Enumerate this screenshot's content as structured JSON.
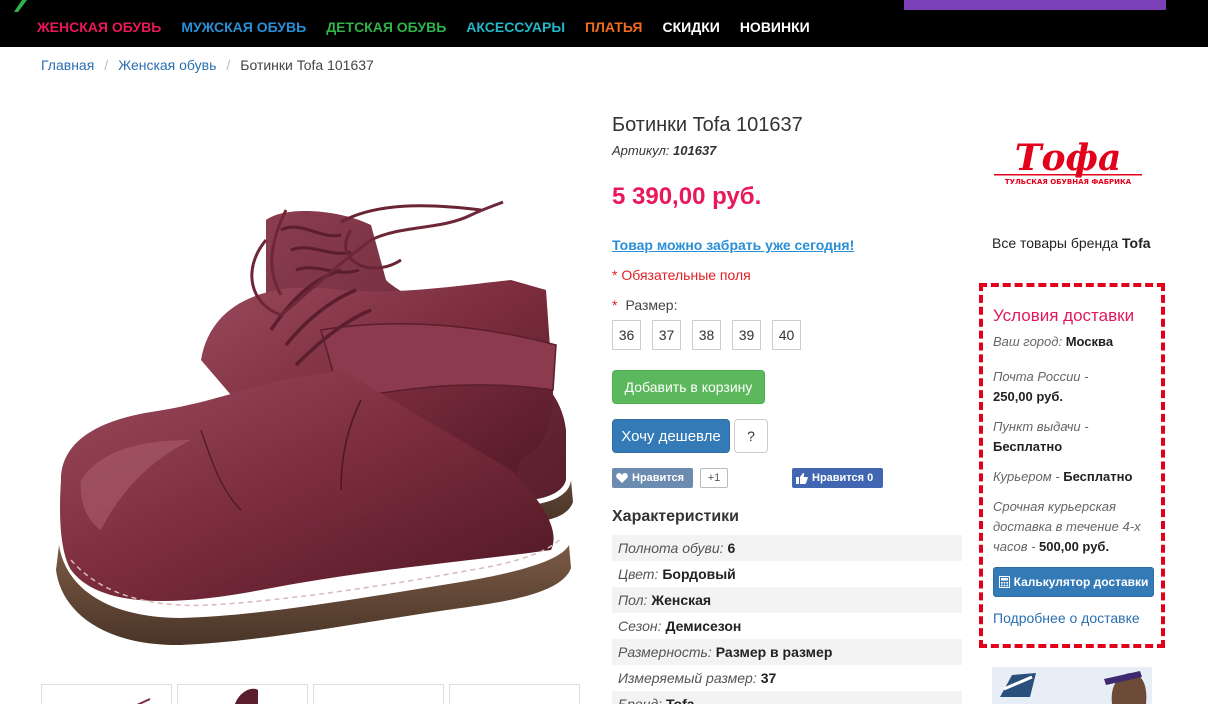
{
  "nav": {
    "items": [
      {
        "label": "ЖЕНСКАЯ ОБУВЬ",
        "color": "#e8185a"
      },
      {
        "label": "МУЖСКАЯ ОБУВЬ",
        "color": "#2a8fd6"
      },
      {
        "label": "ДЕТСКАЯ ОБУВЬ",
        "color": "#2fb34a"
      },
      {
        "label": "АКСЕССУАРЫ",
        "color": "#23b5c8"
      },
      {
        "label": "ПЛАТЬЯ",
        "color": "#f06a1f"
      },
      {
        "label": "СКИДКИ",
        "color": "#ffffff"
      },
      {
        "label": "НОВИНКИ",
        "color": "#ffffff"
      }
    ]
  },
  "breadcrumb": {
    "home": "Главная",
    "section": "Женская обувь",
    "current": "Ботинки Tofa 101637",
    "separator": "/"
  },
  "product": {
    "title": "Ботинки Tofa 101637",
    "sku_label": "Артикул:",
    "sku": "101637",
    "price": "5 390,00 руб.",
    "pickup_today": "Товар можно забрать уже сегодня!",
    "required_note": "* Обязательные поля",
    "size_star": "*",
    "size_label": "Размер:",
    "sizes": [
      "36",
      "37",
      "38",
      "39",
      "40"
    ],
    "add_to_cart": "Добавить в корзину",
    "want_cheaper": "Хочу дешевле",
    "question": "?"
  },
  "social": {
    "vk_like": "Нравится",
    "vk_count": "+1",
    "fb_like": "Нравится 0"
  },
  "characteristics": {
    "title": "Характеристики",
    "rows": [
      {
        "key": "Полнота обуви:",
        "value": "6"
      },
      {
        "key": "Цвет:",
        "value": "Бордовый"
      },
      {
        "key": "Пол:",
        "value": "Женская"
      },
      {
        "key": "Сезон:",
        "value": "Демисезон"
      },
      {
        "key": "Размерность:",
        "value": "Размер в размер"
      },
      {
        "key": "Измеряемый размер:",
        "value": "37"
      },
      {
        "key": "Бренд:",
        "value": "Tofa"
      }
    ]
  },
  "brand": {
    "logo_text": "Тофа",
    "logo_subtext": "ТУЛЬСКАЯ ОБУВНАЯ ФАБРИКА",
    "all_goods": "Все товары бренда",
    "name": "Tofa"
  },
  "delivery": {
    "title": "Условия доставки",
    "city_label": "Ваш город:",
    "city": "Москва",
    "post_label": "Почта России -",
    "post_price": "250,00 руб.",
    "pickup_label": "Пункт выдачи -",
    "pickup_price": "Бесплатно",
    "courier_label": "Курьером -",
    "courier_price": "Бесплатно",
    "express_label": "Срочная курьерская доставка в течение 4-х часов -",
    "express_price": "500,00 руб.",
    "calc_button": "Калькулятор доставки",
    "more_link": "Подробнее о доставке"
  },
  "colors": {
    "accent_price": "#e8185a",
    "delivery_border": "#e3001b",
    "primary_button": "#337ab7",
    "success_button": "#5cb85c",
    "boot_color": "#7a2c3c"
  }
}
